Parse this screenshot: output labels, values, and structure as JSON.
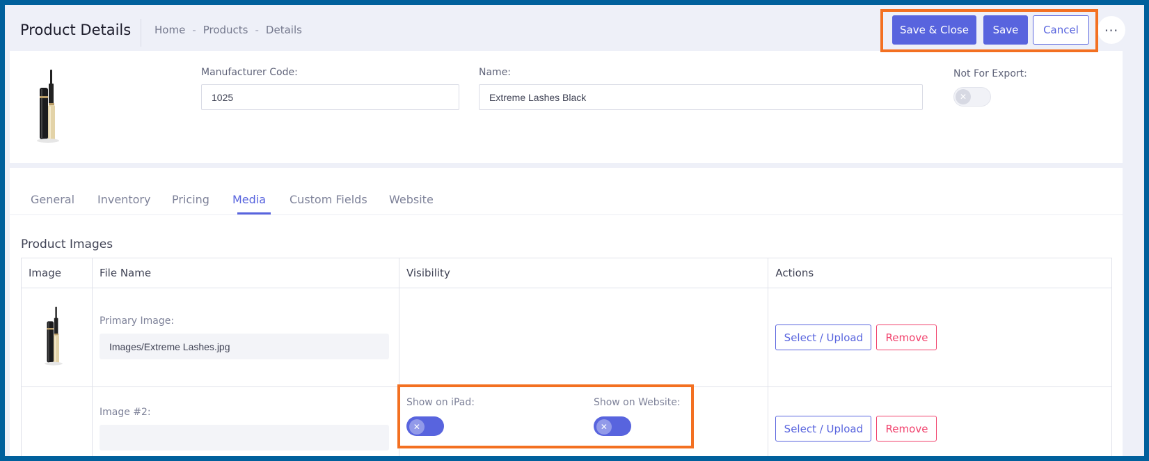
{
  "header": {
    "title": "Product Details",
    "breadcrumb": [
      "Home",
      "Products",
      "Details"
    ],
    "breadcrumb_sep": "-",
    "save_close_label": "Save & Close",
    "save_label": "Save",
    "cancel_label": "Cancel",
    "more_label": "⋯"
  },
  "product": {
    "manufacturer_code_label": "Manufacturer Code:",
    "manufacturer_code": "1025",
    "name_label": "Name:",
    "name": "Extreme Lashes Black",
    "not_for_export_label": "Not For Export:",
    "not_for_export": false
  },
  "tabs": [
    {
      "label": "General",
      "active": false
    },
    {
      "label": "Inventory",
      "active": false
    },
    {
      "label": "Pricing",
      "active": false
    },
    {
      "label": "Media",
      "active": true
    },
    {
      "label": "Custom Fields",
      "active": false
    },
    {
      "label": "Website",
      "active": false
    }
  ],
  "media": {
    "section_title": "Product Images",
    "columns": [
      "Image",
      "File Name",
      "Visibility",
      "Actions"
    ],
    "rows": [
      {
        "label": "Primary Image:",
        "file": "Images/Extreme Lashes.jpg",
        "has_thumb": true,
        "select_label": "Select / Upload",
        "remove_label": "Remove"
      },
      {
        "label": "Image #2:",
        "file": "",
        "has_thumb": false,
        "show_ipad_label": "Show on iPad:",
        "show_ipad": true,
        "show_website_label": "Show on Website:",
        "show_website": true,
        "select_label": "Select / Upload",
        "remove_label": "Remove"
      }
    ]
  },
  "colors": {
    "accent": "#5864de",
    "danger": "#f1416c",
    "highlight": "#f37021",
    "outer_border": "#00609c"
  },
  "icons": {
    "toggle_knob": "x-icon",
    "more": "ellipsis-icon",
    "product_image": "mascara-image"
  }
}
